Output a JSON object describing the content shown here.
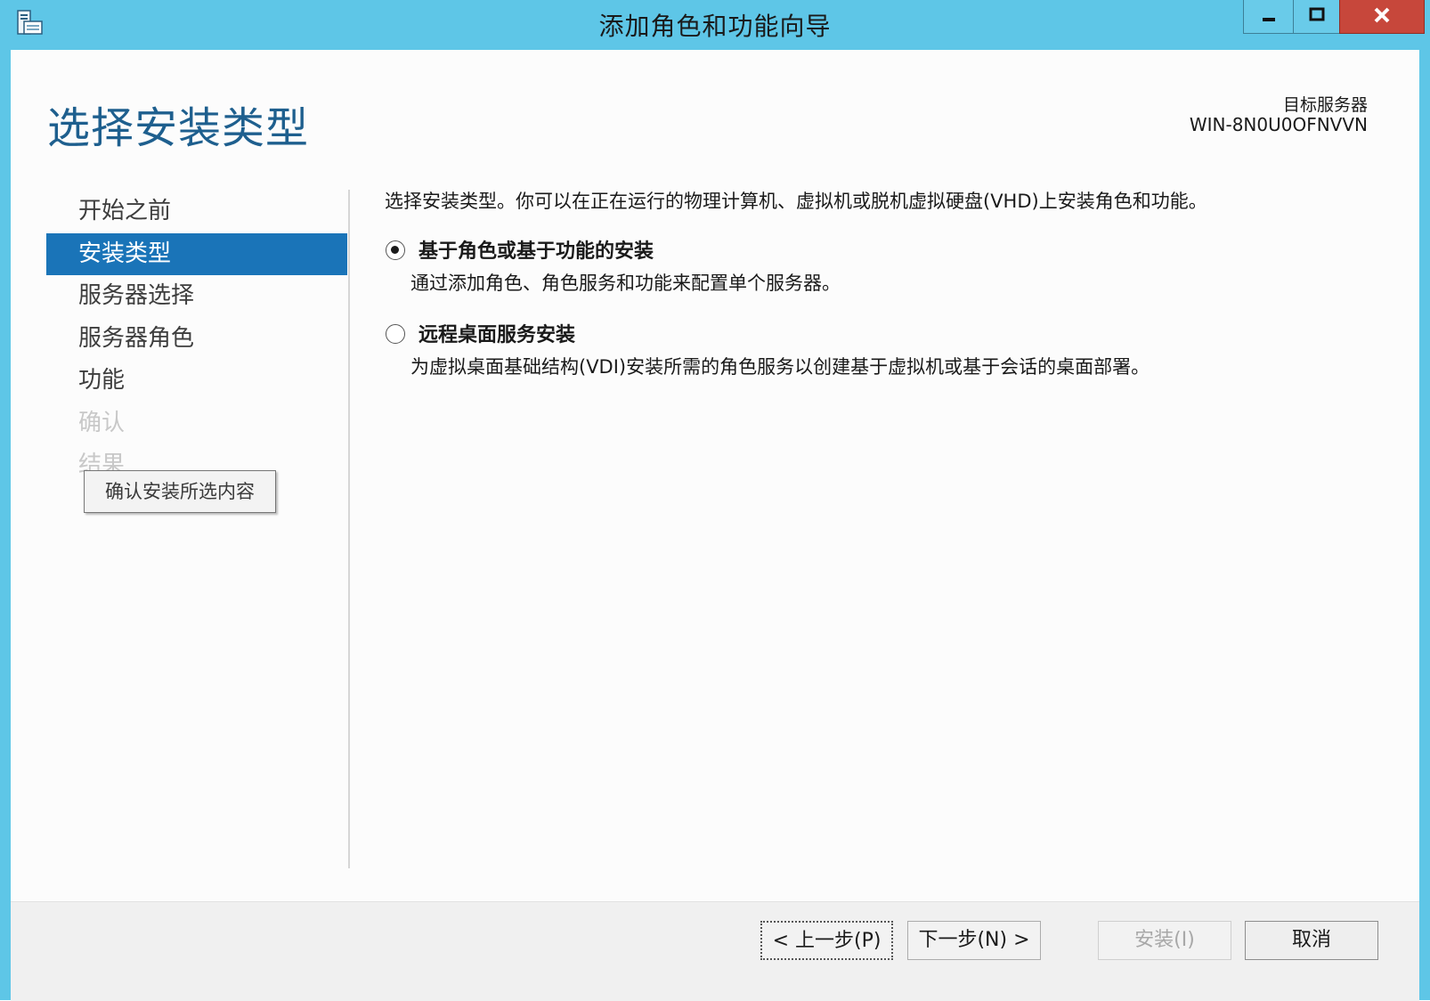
{
  "window": {
    "title": "添加角色和功能向导",
    "controls": {
      "minimize_icon": "minimize-icon",
      "maximize_icon": "maximize-icon",
      "close_label": "x"
    }
  },
  "header": {
    "page_title": "选择安装类型",
    "target_label": "目标服务器",
    "target_name": "WIN-8N0U0OFNVVN"
  },
  "nav": {
    "items": [
      {
        "label": "开始之前",
        "state": "normal"
      },
      {
        "label": "安装类型",
        "state": "active"
      },
      {
        "label": "服务器选择",
        "state": "normal"
      },
      {
        "label": "服务器角色",
        "state": "normal"
      },
      {
        "label": "功能",
        "state": "normal"
      },
      {
        "label": "确认",
        "state": "disabled"
      },
      {
        "label": "结果",
        "state": "disabled"
      }
    ],
    "tooltip": "确认安装所选内容"
  },
  "main": {
    "intro": "选择安装类型。你可以在正在运行的物理计算机、虚拟机或脱机虚拟硬盘(VHD)上安装角色和功能。",
    "options": [
      {
        "label": "基于角色或基于功能的安装",
        "description": "通过添加角色、角色服务和功能来配置单个服务器。",
        "selected": true
      },
      {
        "label": "远程桌面服务安装",
        "description": "为虚拟桌面基础结构(VDI)安装所需的角色服务以创建基于虚拟机或基于会话的桌面部署。",
        "selected": false
      }
    ]
  },
  "footer": {
    "prev_label": "< 上一步(P)",
    "next_label": "下一步(N) >",
    "install_label": "安装(I)",
    "cancel_label": "取消"
  },
  "colors": {
    "frame": "#5ec6e7",
    "accent": "#1a74b8",
    "title": "#1e5f8e",
    "close": "#c7473b"
  }
}
